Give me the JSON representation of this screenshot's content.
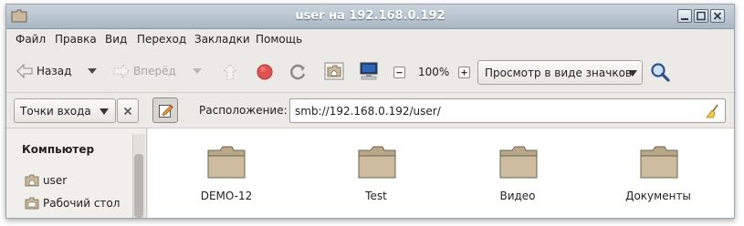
{
  "window": {
    "title": "user на 192.168.0.192"
  },
  "menu": [
    "Файл",
    "Правка",
    "Вид",
    "Переход",
    "Закладки",
    "Помощь"
  ],
  "toolbar": {
    "back_label": "Назад",
    "forward_label": "Вперёд",
    "zoom": "100%",
    "view_mode": "Просмотр в виде значков"
  },
  "location_bar": {
    "places_label": "Точки входа",
    "location_label": "Расположение:",
    "path": "smb://192.168.0.192/user/"
  },
  "sidebar": {
    "heading": "Компьютер",
    "items": [
      {
        "label": "user",
        "icon": "home-folder-icon"
      },
      {
        "label": "Рабочий стол",
        "icon": "desktop-folder-icon"
      }
    ]
  },
  "files": [
    {
      "name": "DEMO-12"
    },
    {
      "name": "Test"
    },
    {
      "name": "Видео"
    },
    {
      "name": "Документы"
    }
  ]
}
